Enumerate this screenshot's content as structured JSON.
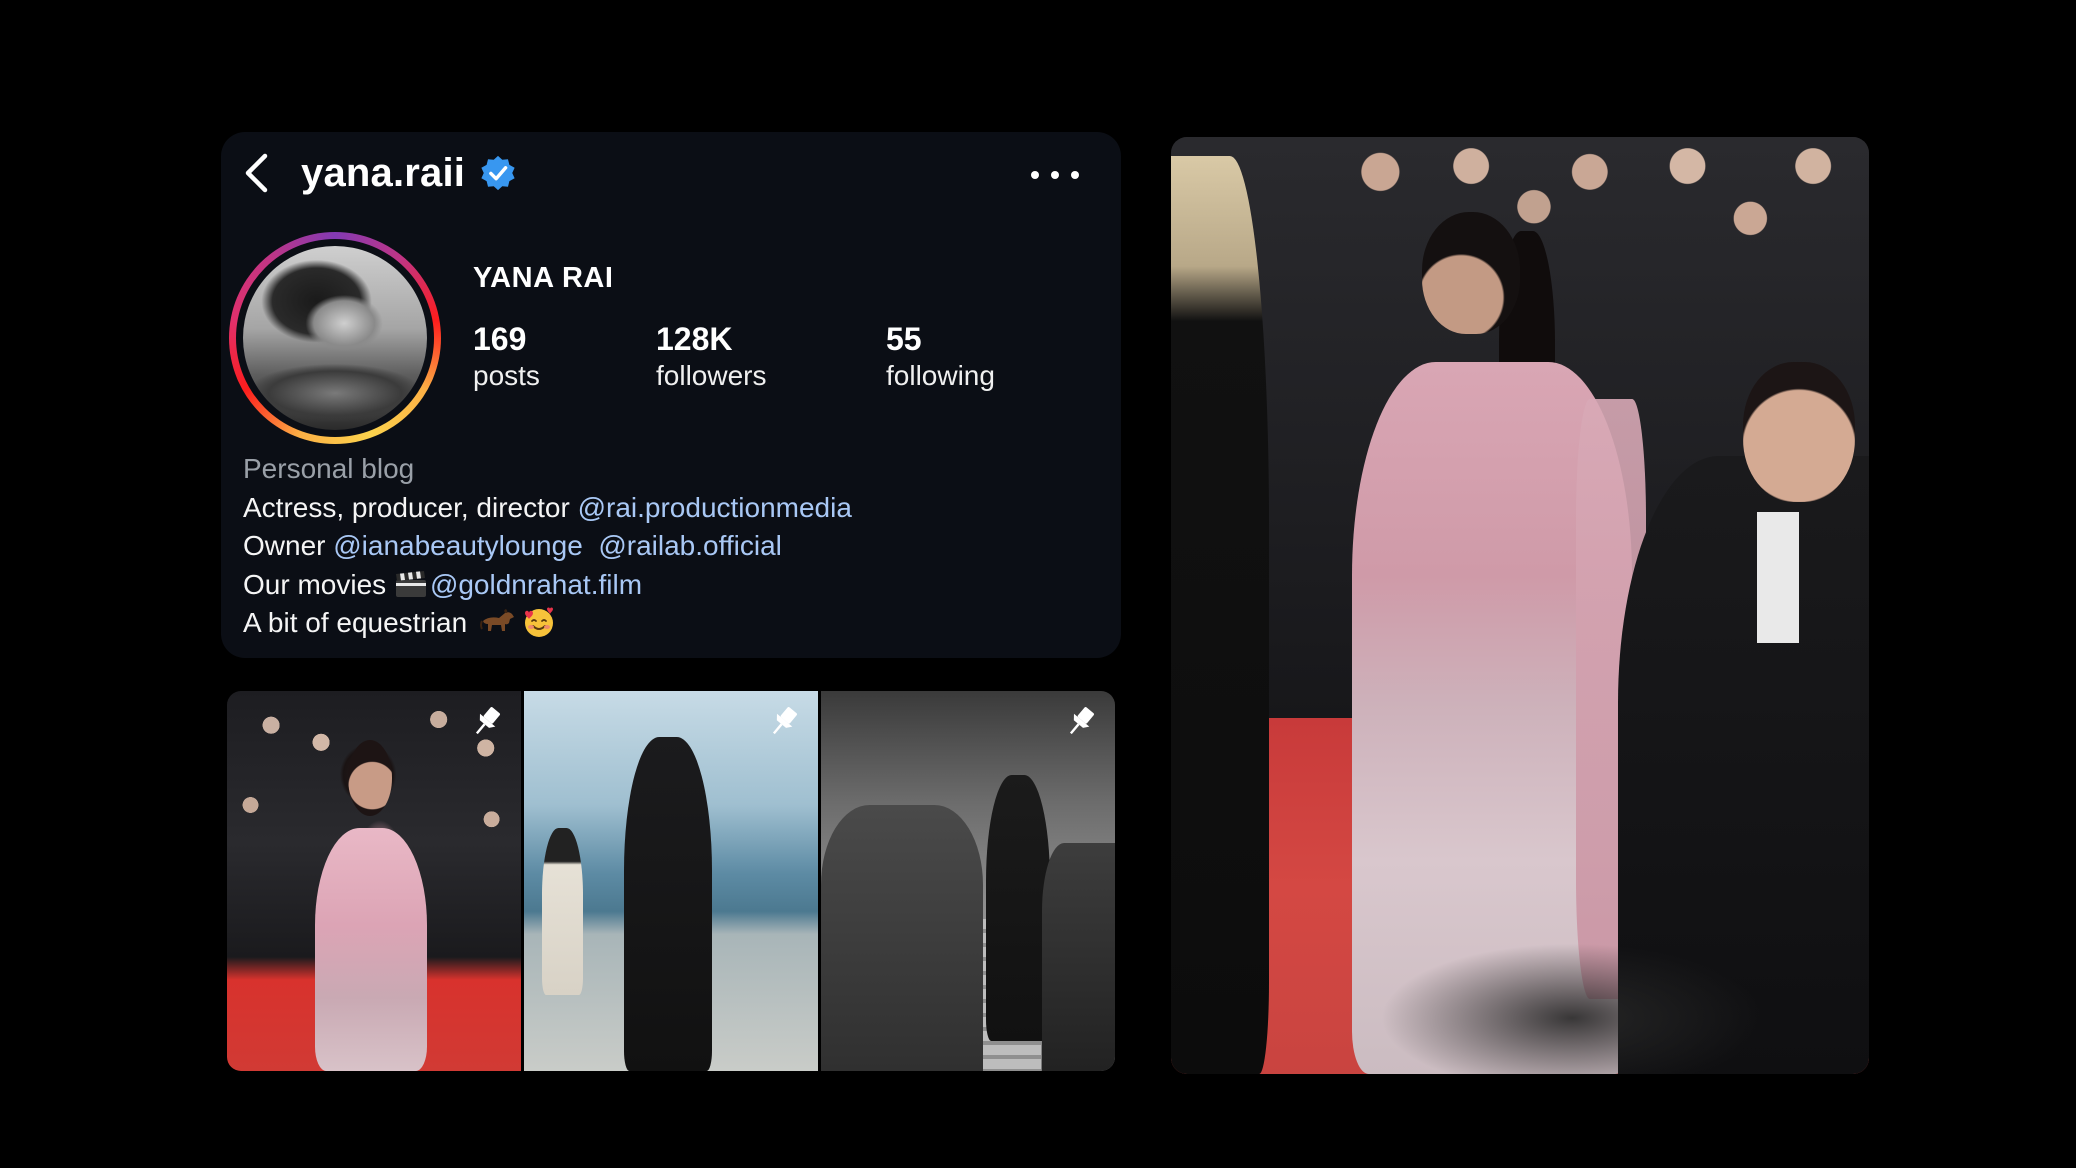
{
  "profile": {
    "username": "yana.raii",
    "verified": true,
    "display_name": "YANA RAI",
    "stats": [
      {
        "value": "169",
        "label": "posts"
      },
      {
        "value": "128K",
        "label": "followers"
      },
      {
        "value": "55",
        "label": "following"
      }
    ],
    "bio": {
      "category": "Personal blog",
      "line1_text": "Actress, producer, director ",
      "line1_link": "@rai.productionmedia",
      "line2_text": "Owner ",
      "line2_link1": "@ianabeautylounge",
      "line2_link2": "@railab.official",
      "line3_text": "Our movies ",
      "line3_link": "@goldnrahat.film",
      "line4_text": "A bit of equestrian "
    }
  },
  "icons": {
    "back": "chevron-left-icon",
    "verified": "verified-badge-icon",
    "more": "more-horizontal-icon",
    "pin": "pin-icon",
    "clapper": "clapper-board-emoji",
    "horse": "horse-emoji",
    "face": "smiling-face-with-hearts-emoji"
  },
  "colors": {
    "background": "#000000",
    "card": "#0b0e15",
    "link": "#a9c8f5",
    "verified_blue": "#3897f0",
    "muted": "#9aa0a8"
  },
  "grid": {
    "tiles": [
      {
        "pinned": true
      },
      {
        "pinned": true
      },
      {
        "pinned": true
      }
    ]
  }
}
